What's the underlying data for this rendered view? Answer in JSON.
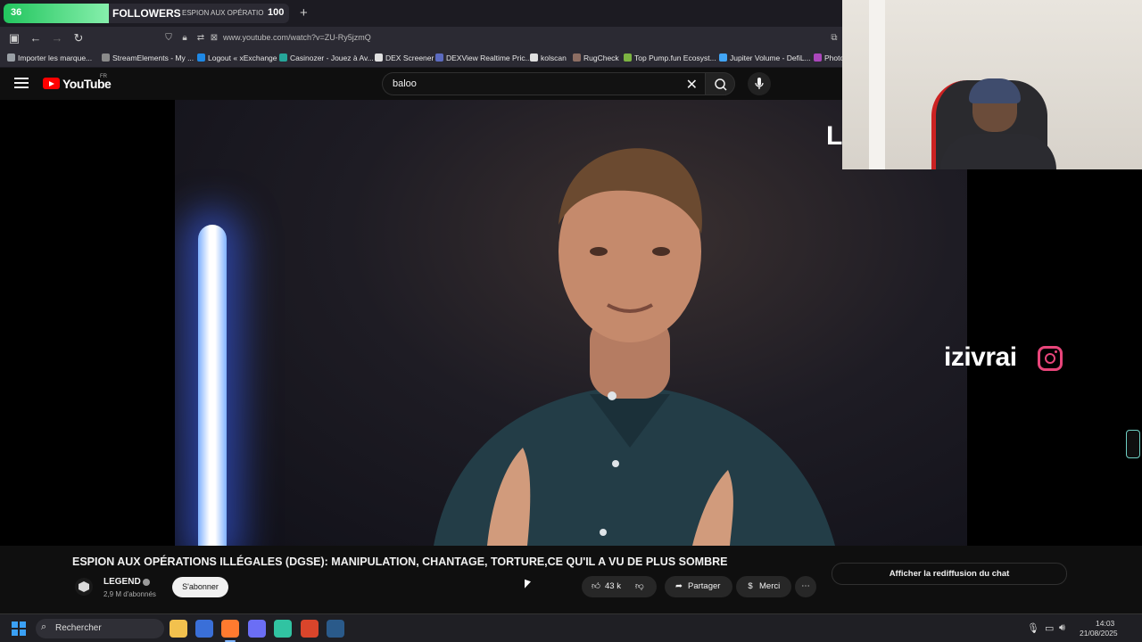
{
  "browser": {
    "follower_widget": {
      "count": "36",
      "label": "FOLLOWERS",
      "sub": "ESPION AUX OPÉRATIO",
      "goal": "100",
      "progress_percent": 36
    },
    "new_tab_label": "+",
    "url": "www.youtube.com/watch?v=ZU-Ry5jzmQ",
    "bookmarks": [
      {
        "label": "Importer les marque...",
        "color": "#9aa0a6"
      },
      {
        "label": "StreamElements - My ...",
        "color": "#8a8a8a"
      },
      {
        "label": "Logout « xExchange",
        "color": "#1e88e5"
      },
      {
        "label": "Casinozer - Jouez à Av...",
        "color": "#26a69a"
      },
      {
        "label": "DEX Screener",
        "color": "#e0e0e0"
      },
      {
        "label": "DEXView Realtime Pric...",
        "color": "#5c6bc0"
      },
      {
        "label": "kolscan",
        "color": "#e0e0e0"
      },
      {
        "label": "RugCheck",
        "color": "#8d6e63"
      },
      {
        "label": "Top Pump.fun Ecosyst...",
        "color": "#7cb342"
      },
      {
        "label": "Jupiter Volume - DefiL...",
        "color": "#42a5f5"
      },
      {
        "label": "Photo",
        "color": "#ab47bc"
      }
    ]
  },
  "youtube": {
    "logo_text": "YouTube",
    "country": "FR",
    "search_value": "baloo",
    "video_overlay_letter": "L",
    "watermark": "izivrai",
    "title": "ESPION AUX OPÉRATIONS ILLÉGALES (DGSE): MANIPULATION, CHANTAGE, TORTURE,CE QU'IL A VU DE PLUS SOMBRE",
    "channel": {
      "name": "LEGEND",
      "subscribers": "2,9 M d'abonnés",
      "subscribe_label": "S'abonner"
    },
    "actions": {
      "likes": "43 k",
      "share": "Partager",
      "thanks": "Merci",
      "more": "⋯"
    },
    "chat_replay_label": "Afficher la rediffusion du chat"
  },
  "taskbar": {
    "search_placeholder": "Rechercher",
    "time": "14:03",
    "date": "21/08/2025",
    "apps": [
      {
        "name": "file-explorer",
        "color": "#f2c14e"
      },
      {
        "name": "store",
        "color": "#3a6fd8"
      },
      {
        "name": "firefox",
        "color": "#ff7a2f"
      },
      {
        "name": "discord",
        "color": "#6b6ef5"
      },
      {
        "name": "streamlabs",
        "color": "#31c3a2"
      },
      {
        "name": "obs-alt",
        "color": "#d9452b"
      },
      {
        "name": "steam",
        "color": "#2a5a8a"
      }
    ]
  }
}
